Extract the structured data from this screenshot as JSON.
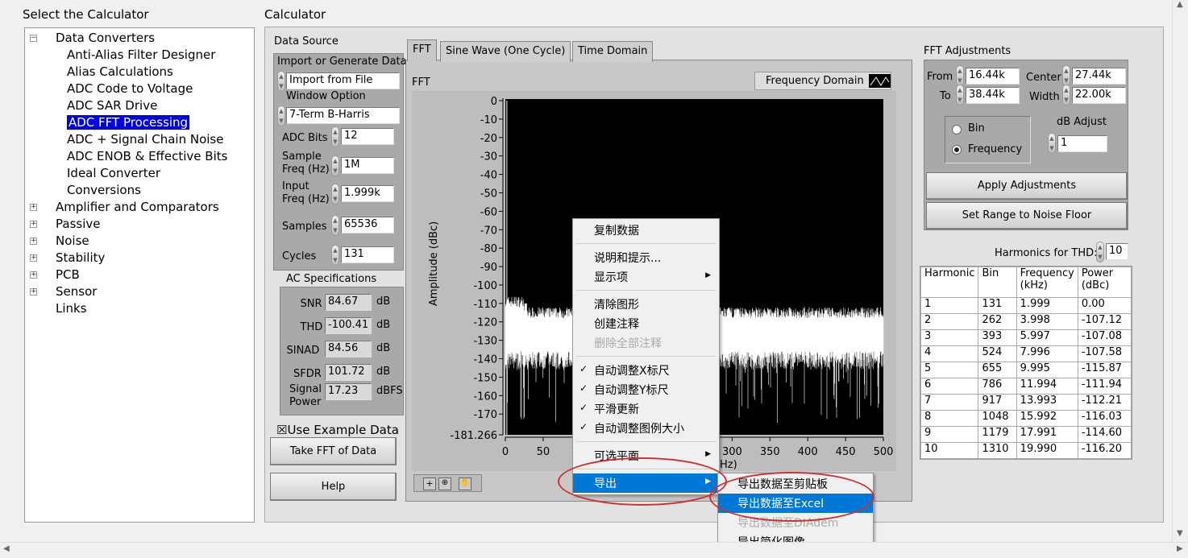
{
  "left_title": "Select the Calculator",
  "main_title": "Calculator",
  "tree": [
    {
      "label": "Data Converters",
      "level": 0,
      "expander": "−"
    },
    {
      "label": "Anti-Alias Filter Designer",
      "level": 1
    },
    {
      "label": "Alias Calculations",
      "level": 1
    },
    {
      "label": "ADC Code to Voltage",
      "level": 1
    },
    {
      "label": "ADC SAR Drive",
      "level": 1
    },
    {
      "label": "ADC FFT Processing",
      "level": 1,
      "selected": true
    },
    {
      "label": "ADC + Signal Chain Noise",
      "level": 1
    },
    {
      "label": "ADC ENOB & Effective Bits",
      "level": 1
    },
    {
      "label": "Ideal Converter",
      "level": 1
    },
    {
      "label": "Conversions",
      "level": 1
    },
    {
      "label": "Amplifier and Comparators",
      "level": 0,
      "expander": "+"
    },
    {
      "label": "Passive",
      "level": 0,
      "expander": "+"
    },
    {
      "label": "Noise",
      "level": 0,
      "expander": "+"
    },
    {
      "label": "Stability",
      "level": 0,
      "expander": "+"
    },
    {
      "label": "PCB",
      "level": 0,
      "expander": "+"
    },
    {
      "label": "Sensor",
      "level": 0,
      "expander": "+"
    },
    {
      "label": "Links",
      "level": 0
    }
  ],
  "data_source": {
    "title": "Data Source",
    "import_label": "Import or Generate Data",
    "import_value": "Import from File",
    "window_label": "Window Option",
    "window_value": "7-Term B-Harris",
    "adc_bits_label": "ADC Bits",
    "adc_bits": "12",
    "sample_freq_label1": "Sample",
    "sample_freq_label2": "Freq (Hz)",
    "sample_freq": "1M",
    "input_freq_label1": "Input",
    "input_freq_label2": "Freq (Hz)",
    "input_freq": "1.999k",
    "samples_label": "Samples",
    "samples": "65536",
    "cycles_label": "Cycles",
    "cycles": "131"
  },
  "ac_specs": {
    "title": "AC Specifications",
    "rows": [
      {
        "label": "SNR",
        "value": "84.67",
        "unit": "dB"
      },
      {
        "label": "THD",
        "value": "-100.41",
        "unit": "dB"
      },
      {
        "label": "SINAD",
        "value": "84.56",
        "unit": "dB"
      },
      {
        "label": "SFDR",
        "value": "101.72",
        "unit": "dB"
      },
      {
        "label": "Signal Power",
        "value": "17.23",
        "unit": "dBFS"
      }
    ]
  },
  "use_example": {
    "label": "Use Example Data",
    "checked": "☒"
  },
  "buttons": {
    "take_fft": "Take FFT of Data",
    "help": "Help",
    "apply": "Apply Adjustments",
    "noise_floor": "Set Range to Noise Floor"
  },
  "tabs": [
    "FFT",
    "Sine Wave (One Cycle)",
    "Time Domain"
  ],
  "plot": {
    "title": "FFT",
    "legend": "Frequency Domain",
    "y_label": "Amplitude (dBc)",
    "x_label_partial": "Hz)"
  },
  "chart_data": {
    "type": "line",
    "title": "FFT",
    "ylabel": "Amplitude (dBc)",
    "xlabel": "Frequency (kHz)",
    "ylim": [
      -181.266,
      0
    ],
    "xlim": [
      0,
      500
    ],
    "y_ticks": [
      "0",
      "-10",
      "-20",
      "-30",
      "-40",
      "-50",
      "-60",
      "-70",
      "-80",
      "-90",
      "-100",
      "-110",
      "-120",
      "-130",
      "-140",
      "-150",
      "-160",
      "-170",
      "-181.266"
    ],
    "y_tick_values": [
      0,
      -10,
      -20,
      -30,
      -40,
      -50,
      -60,
      -70,
      -80,
      -90,
      -100,
      -110,
      -120,
      -130,
      -140,
      -150,
      -160,
      -170,
      -181.266
    ],
    "x_ticks": [
      "0",
      "50",
      "100",
      "150",
      "200",
      "250",
      "300",
      "350",
      "400",
      "450",
      "500"
    ],
    "x_tick_values": [
      0,
      50,
      100,
      150,
      200,
      250,
      300,
      350,
      400,
      450,
      500
    ],
    "noise_floor_dbc": -130,
    "spur_khz": 27,
    "spur_dbc": -110
  },
  "context_menu": {
    "items": [
      {
        "label": "复制数据"
      },
      {
        "sep": true
      },
      {
        "label": "说明和提示..."
      },
      {
        "label": "显示项",
        "submenu": true
      },
      {
        "sep": true
      },
      {
        "label": "清除图形"
      },
      {
        "label": "创建注释"
      },
      {
        "label": "删除全部注释",
        "disabled": true
      },
      {
        "sep": true
      },
      {
        "label": "自动调整X标尺",
        "checked": true
      },
      {
        "label": "自动调整Y标尺",
        "checked": true
      },
      {
        "label": "平滑更新",
        "checked": true
      },
      {
        "label": "自动调整图例大小",
        "checked": true
      },
      {
        "sep": true
      },
      {
        "label": "可选平面",
        "submenu": true
      },
      {
        "sep": true
      },
      {
        "label": "导出",
        "submenu": true,
        "highlighted": true
      }
    ],
    "check": "✓",
    "arrow": "▶",
    "submenu": [
      {
        "label": "导出数据至剪贴板"
      },
      {
        "label": "导出数据至Excel",
        "highlighted": true
      },
      {
        "label": "导出数据至DIAdem",
        "disabled": true
      },
      {
        "label": "导出简化图像..."
      }
    ]
  },
  "fft_adj": {
    "title": "FFT Adjustments",
    "from_label": "From",
    "from": "16.44k",
    "to_label": "To",
    "to": "38.44k",
    "center_label": "Center",
    "center": "27.44k",
    "width_label": "Width",
    "width": "22.00k",
    "bin_label": "Bin",
    "freq_label": "Frequency",
    "selected": "Frequency",
    "db_adjust_label": "dB Adjust",
    "db_adjust": "1"
  },
  "harmonics": {
    "label": "Harmonics for THD:",
    "count": "10",
    "headers": [
      "Harmonic",
      "Bin",
      "Frequency (kHz)",
      "Power (dBc)"
    ],
    "rows": [
      [
        "1",
        "131",
        "1.999",
        "0.00"
      ],
      [
        "2",
        "262",
        "3.998",
        "-107.12"
      ],
      [
        "3",
        "393",
        "5.997",
        "-107.08"
      ],
      [
        "4",
        "524",
        "7.996",
        "-107.58"
      ],
      [
        "5",
        "655",
        "9.995",
        "-115.87"
      ],
      [
        "6",
        "786",
        "11.994",
        "-111.94"
      ],
      [
        "7",
        "917",
        "13.993",
        "-112.21"
      ],
      [
        "8",
        "1048",
        "15.992",
        "-116.03"
      ],
      [
        "9",
        "1179",
        "17.991",
        "-114.60"
      ],
      [
        "10",
        "1310",
        "19.990",
        "-116.20"
      ]
    ]
  },
  "colors": {
    "selection": "#0000e0",
    "menu_highlight": "#0078d7",
    "annotation": "#d03030"
  }
}
